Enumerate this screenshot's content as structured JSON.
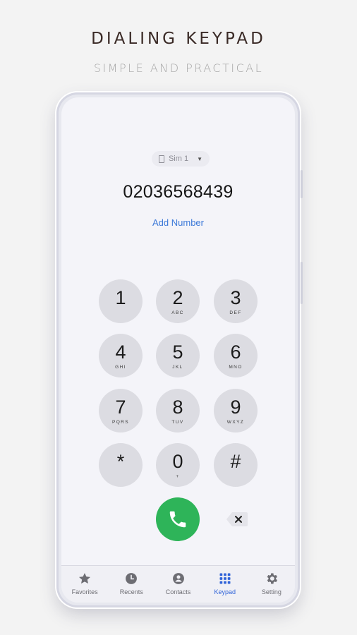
{
  "promo": {
    "title": "DIALING KEYPAD",
    "subtitle": "SIMPLE AND PRACTICAL"
  },
  "sim": {
    "label": "Sim 1"
  },
  "dialer": {
    "number": "02036568439",
    "add_number_label": "Add Number"
  },
  "keypad": [
    {
      "digit": "1",
      "letters": ""
    },
    {
      "digit": "2",
      "letters": "ABC"
    },
    {
      "digit": "3",
      "letters": "DEF"
    },
    {
      "digit": "4",
      "letters": "GHI"
    },
    {
      "digit": "5",
      "letters": "JKL"
    },
    {
      "digit": "6",
      "letters": "MNO"
    },
    {
      "digit": "7",
      "letters": "PQRS"
    },
    {
      "digit": "8",
      "letters": "TUV"
    },
    {
      "digit": "9",
      "letters": "WXYZ"
    },
    {
      "digit": "*",
      "letters": ""
    },
    {
      "digit": "0",
      "letters": "+"
    },
    {
      "digit": "#",
      "letters": ""
    }
  ],
  "colors": {
    "call_button": "#2eb459",
    "accent": "#2f63d8",
    "key_background": "#dcdce2"
  },
  "tabs": [
    {
      "label": "Favorites",
      "icon": "star-icon"
    },
    {
      "label": "Recents",
      "icon": "clock-icon"
    },
    {
      "label": "Contacts",
      "icon": "person-icon"
    },
    {
      "label": "Keypad",
      "icon": "keypad-icon",
      "active": true
    },
    {
      "label": "Setting",
      "icon": "gear-icon"
    }
  ]
}
